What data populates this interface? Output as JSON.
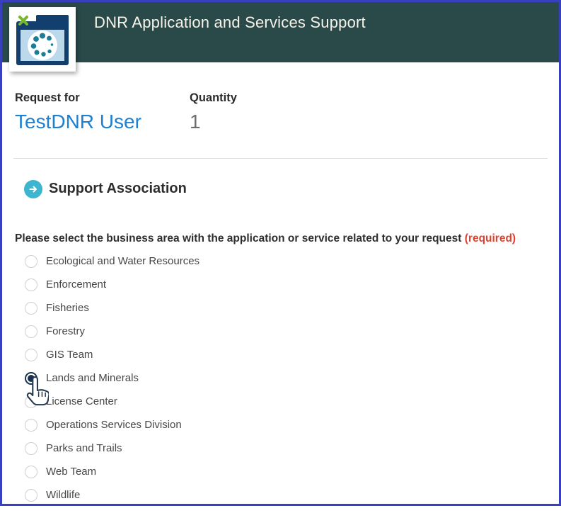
{
  "header": {
    "title": "DNR Application and Services Support",
    "icon_name": "catalog-item-folder-icon"
  },
  "meta": {
    "request_for_label": "Request for",
    "request_for_value": "TestDNR User",
    "quantity_label": "Quantity",
    "quantity_value": "1"
  },
  "section": {
    "title": "Support Association",
    "icon_name": "arrow-right-circle-icon"
  },
  "form": {
    "question": "Please select the business area with the application or service related to your request",
    "required_label": "(required)",
    "selected_option": "Lands and Minerals",
    "options": [
      {
        "label": "Ecological and Water Resources",
        "selected": false
      },
      {
        "label": "Enforcement",
        "selected": false
      },
      {
        "label": "Fisheries",
        "selected": false
      },
      {
        "label": "Forestry",
        "selected": false
      },
      {
        "label": "GIS Team",
        "selected": false
      },
      {
        "label": "Lands and Minerals",
        "selected": true
      },
      {
        "label": "License Center",
        "selected": false
      },
      {
        "label": "Operations Services Division",
        "selected": false
      },
      {
        "label": "Parks and Trails",
        "selected": false
      },
      {
        "label": "Web Team",
        "selected": false
      },
      {
        "label": "Wildlife",
        "selected": false
      }
    ]
  },
  "cursor": {
    "type": "hand-pointer",
    "over_option": "Lands and Minerals"
  },
  "colors": {
    "page_border": "#3940c0",
    "header_bg": "#2a4a4a",
    "header_text": "#f7f3ea",
    "accent_cyan": "#3db5ce",
    "link_blue": "#1f80d0",
    "quantity_gray": "#6e6e6e",
    "required_red": "#e0402e",
    "radio_selected": "#16324f",
    "icon_navy": "#123f6e",
    "icon_light_blue": "#bcd9ec",
    "icon_teal_dots": "#1c7d96",
    "icon_green_x": "#76b82a"
  }
}
